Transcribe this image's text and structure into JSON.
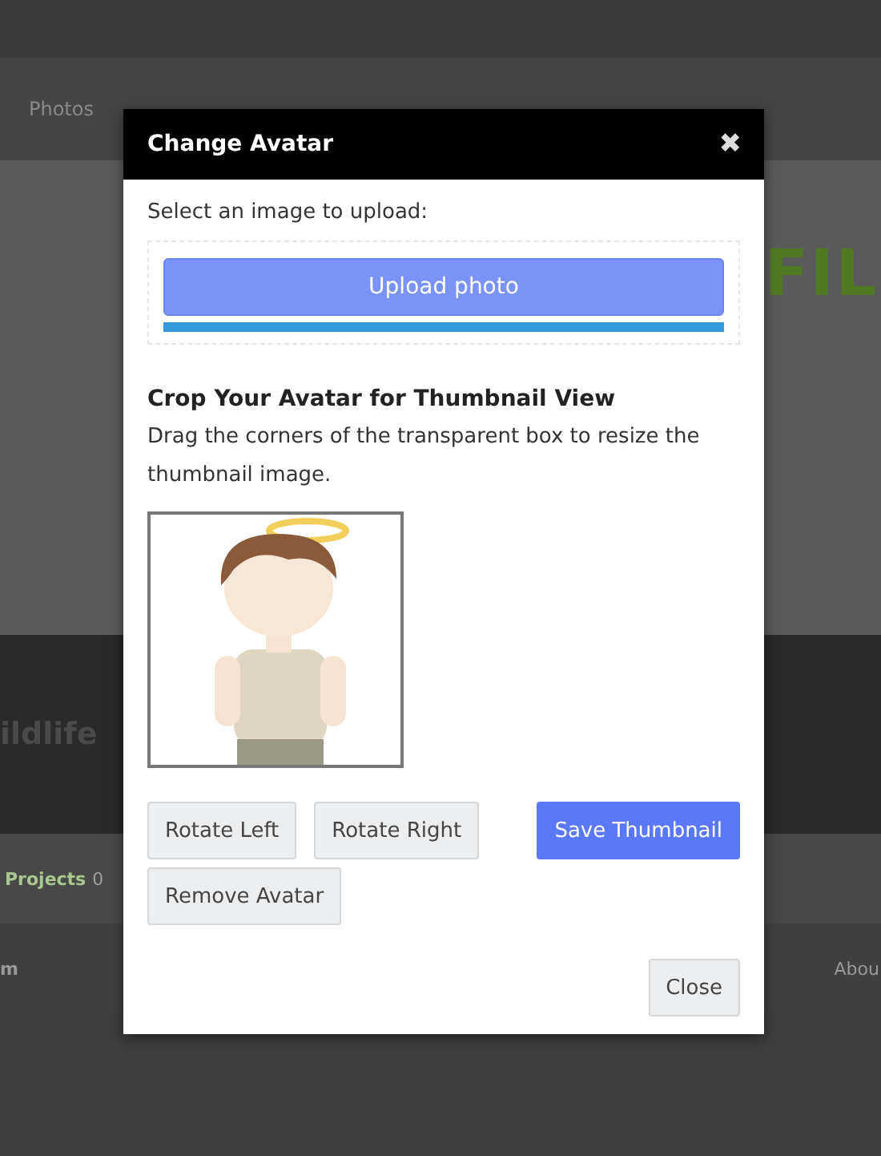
{
  "background_page": {
    "nav": [
      "Photos"
    ],
    "banner_text": "FIL",
    "profile_name": "ildlife",
    "stats": {
      "label": "Projects",
      "count": "0"
    },
    "table_header": {
      "column_1": "m",
      "column_2": "Abou"
    }
  },
  "dialog": {
    "title": "Change Avatar",
    "close_icon": "✖",
    "upload_prompt": "Select an image to upload:",
    "upload_button": "Upload photo",
    "upload_progress": {
      "level": 1
    },
    "crop_heading": "Crop Your Avatar for Thumbnail View",
    "crop_help": "Drag the corners of the transparent box to resize the thumbnail image.",
    "buttons": [
      {
        "label": "Rotate Left",
        "kind": "secondary"
      },
      {
        "label": "Rotate Right",
        "kind": "secondary"
      },
      {
        "label": "Save Thumbnail",
        "kind": "primary"
      },
      {
        "label": "Remove Avatar",
        "kind": "secondary"
      }
    ],
    "footer_button": "Close"
  }
}
